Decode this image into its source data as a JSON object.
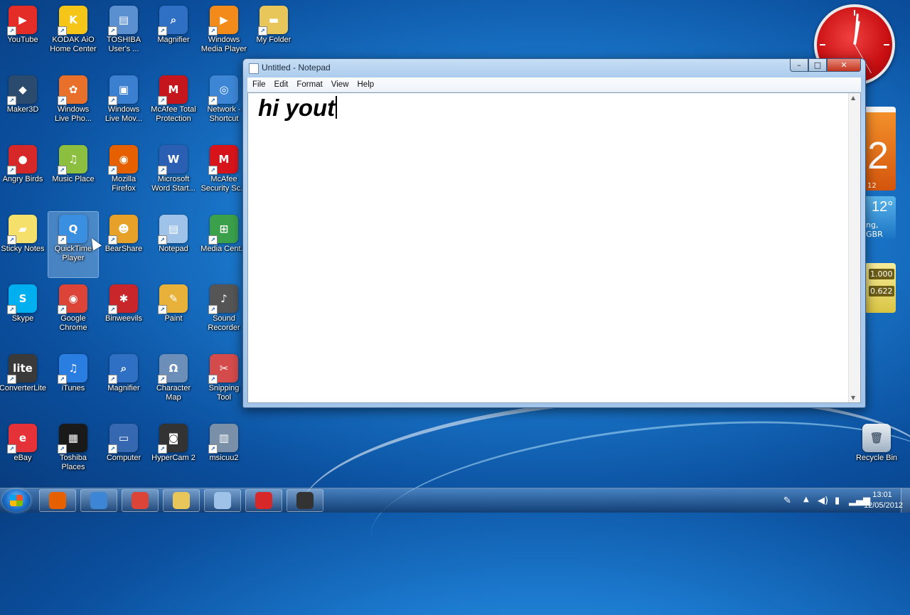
{
  "desktop": {
    "icons": [
      {
        "label": "YouTube",
        "color": "#e52d27",
        "glyph": "▶"
      },
      {
        "label": "KODAK AiO\nHome Center",
        "color": "#f5c518",
        "glyph": "K"
      },
      {
        "label": "TOSHIBA\nUser's ...",
        "color": "#5a8fd0",
        "glyph": "▤"
      },
      {
        "label": "Magnifier",
        "color": "#2f6fc4",
        "glyph": "⌕"
      },
      {
        "label": "Windows\nMedia Player",
        "color": "#f38b1b",
        "glyph": "▶"
      },
      {
        "label": "My Folder",
        "color": "#e8c65a",
        "glyph": "▬"
      },
      {
        "label": "Maker3D",
        "color": "#2a4a6e",
        "glyph": "◆"
      },
      {
        "label": "Windows\nLive Pho...",
        "color": "#e8702a",
        "glyph": "✿"
      },
      {
        "label": "Windows\nLive Mov...",
        "color": "#3b7fd0",
        "glyph": "▣"
      },
      {
        "label": "McAfee Total\nProtection",
        "color": "#c4161c",
        "glyph": "M"
      },
      {
        "label": "Network -\nShortcut",
        "color": "#3d86d6",
        "glyph": "◎"
      },
      {
        "label": "Angry Birds",
        "color": "#d62828",
        "glyph": "●"
      },
      {
        "label": "Music Place",
        "color": "#8cbf3f",
        "glyph": "♫"
      },
      {
        "label": "Mozilla\nFirefox",
        "color": "#e66000",
        "glyph": "◉"
      },
      {
        "label": "Microsoft\nWord Start...",
        "color": "#2b5fb4",
        "glyph": "W"
      },
      {
        "label": "McAfee\nSecurity Sc...",
        "color": "#d8141b",
        "glyph": "M"
      },
      {
        "label": "Sticky Notes",
        "color": "#f4e06a",
        "glyph": "▰"
      },
      {
        "label": "QuickTime\nPlayer",
        "color": "#3a8fe0",
        "glyph": "Q"
      },
      {
        "label": "BearShare",
        "color": "#e8a128",
        "glyph": "☻"
      },
      {
        "label": "Notepad",
        "color": "#9fc3e8",
        "glyph": "▤"
      },
      {
        "label": "Media Cent...",
        "color": "#3aa04a",
        "glyph": "⊞"
      },
      {
        "label": "Skype",
        "color": "#00aff0",
        "glyph": "S"
      },
      {
        "label": "Google\nChrome",
        "color": "#db4437",
        "glyph": "◉"
      },
      {
        "label": "Binweevils",
        "color": "#c9262b",
        "glyph": "✱"
      },
      {
        "label": "Paint",
        "color": "#e8b23a",
        "glyph": "✎"
      },
      {
        "label": "Sound\nRecorder",
        "color": "#555555",
        "glyph": "♪"
      },
      {
        "label": "ConverterLite",
        "color": "#3a3a3a",
        "glyph": "lite"
      },
      {
        "label": "iTunes",
        "color": "#2a7de1",
        "glyph": "♫"
      },
      {
        "label": "Magnifier",
        "color": "#2f6fc4",
        "glyph": "⌕"
      },
      {
        "label": "Character\nMap",
        "color": "#6b8fb8",
        "glyph": "Ω"
      },
      {
        "label": "Snipping\nTool",
        "color": "#d44b4b",
        "glyph": "✂"
      },
      {
        "label": "eBay",
        "color": "#e53238",
        "glyph": "e"
      },
      {
        "label": "Toshiba\nPlaces",
        "color": "#1a1a1a",
        "glyph": "▦"
      },
      {
        "label": "Computer",
        "color": "#3568b0",
        "glyph": "▭"
      },
      {
        "label": "HyperCam 2",
        "color": "#333333",
        "glyph": "◙"
      },
      {
        "label": "msicuu2",
        "color": "#7a8fa8",
        "glyph": "▥"
      }
    ],
    "recycle_bin": {
      "label": "Recycle Bin"
    }
  },
  "gadgets": {
    "calendar_day": "2",
    "calendar_small": "12",
    "weather_temp": "12°",
    "weather_location": "ng, GBR",
    "currency_1": "1.000",
    "currency_2": "0.622"
  },
  "notepad": {
    "title": "Untitled - Notepad",
    "menu": [
      "File",
      "Edit",
      "Format",
      "View",
      "Help"
    ],
    "content": "hi yout",
    "controls": {
      "minimize": "–",
      "maximize": "□",
      "close": "✕"
    }
  },
  "taskbar": {
    "apps": [
      {
        "name": "firefox",
        "color": "#e66000"
      },
      {
        "name": "network",
        "color": "#3d86d6"
      },
      {
        "name": "chrome",
        "color": "#db4437"
      },
      {
        "name": "explorer",
        "color": "#e8c65a"
      },
      {
        "name": "notepad",
        "color": "#9fc3e8"
      },
      {
        "name": "angry-birds",
        "color": "#d62828"
      },
      {
        "name": "hypercam",
        "color": "#333333"
      }
    ],
    "clock_time": "13:01",
    "clock_date": "12/05/2012"
  }
}
